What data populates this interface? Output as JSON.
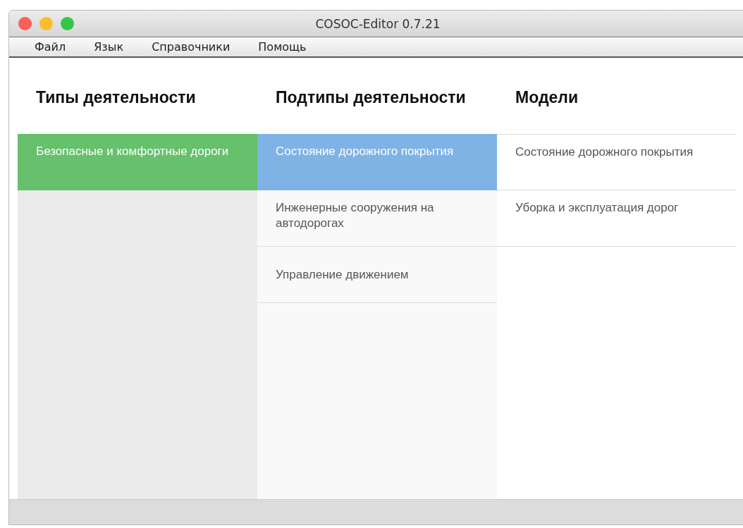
{
  "window": {
    "title": "COSOC-Editor 0.7.21"
  },
  "menu": [
    "Файл",
    "Язык",
    "Справочники",
    "Помощь"
  ],
  "columns": [
    {
      "heading": "Типы деятельности",
      "items": [
        {
          "label": "Безопасные и комфортные дороги",
          "selected": true,
          "color": "#66c06c"
        }
      ]
    },
    {
      "heading": "Подтипы деятельности",
      "items": [
        {
          "label": "Состояние дорожного покрытия",
          "selected": true,
          "color": "#7fb3e5"
        },
        {
          "label": "Инженерные сооружения на автодорогах",
          "selected": false
        },
        {
          "label": "Управление движением",
          "selected": false
        }
      ]
    },
    {
      "heading": "Модели",
      "items": [
        {
          "label": "Состояние дорожного покрытия",
          "selected": false
        },
        {
          "label": "Уборка и эксплуатация дорог",
          "selected": false
        }
      ]
    }
  ]
}
